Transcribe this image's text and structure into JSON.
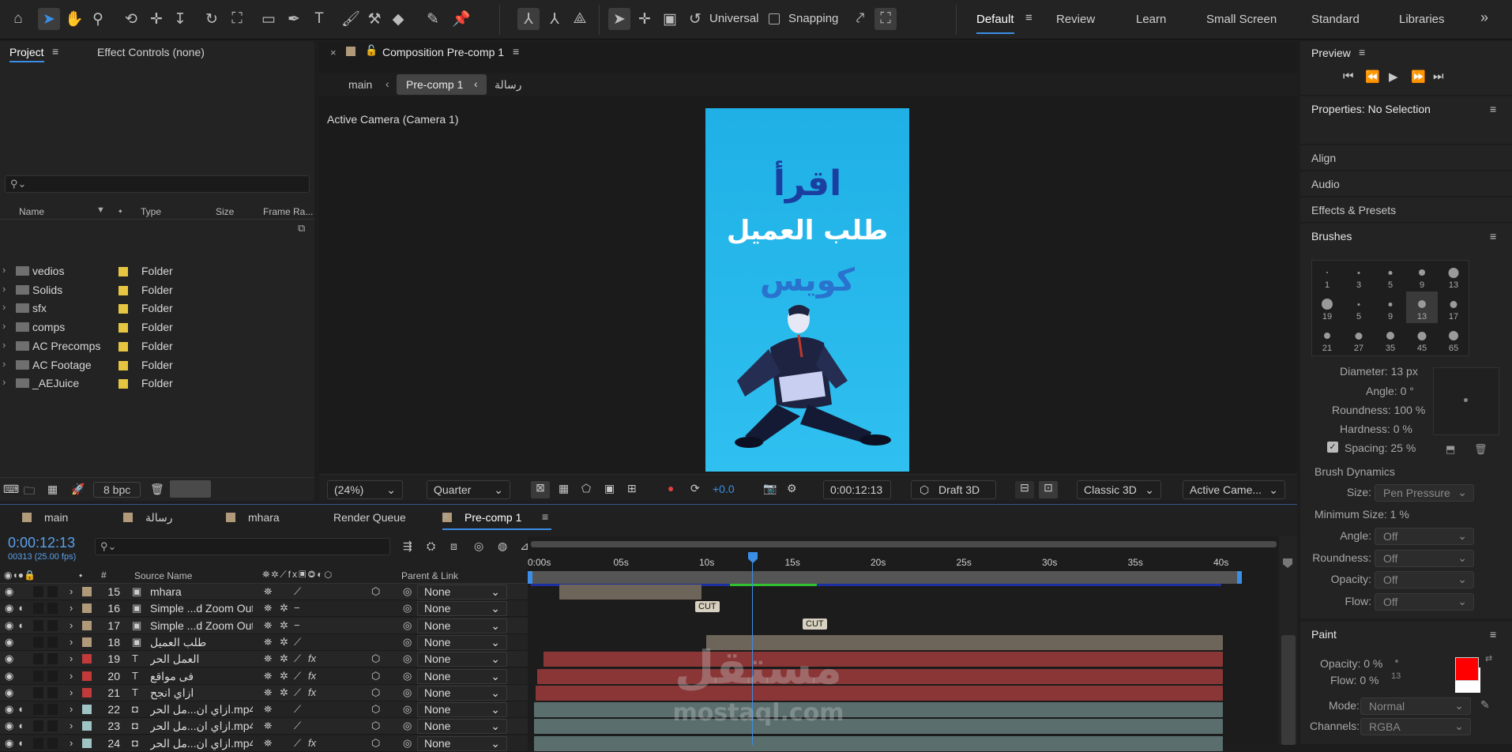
{
  "workspaces": [
    "Default",
    "Review",
    "Learn",
    "Small Screen",
    "Standard",
    "Libraries"
  ],
  "toolbar": {
    "universal": "Universal",
    "snapping": "Snapping"
  },
  "project": {
    "tab_project": "Project",
    "tab_effect": "Effect Controls (none)",
    "cols": {
      "name": "Name",
      "type": "Type",
      "size": "Size",
      "framerate": "Frame Ra..."
    },
    "items": [
      {
        "name": "vedios",
        "type": "Folder"
      },
      {
        "name": "Solids",
        "type": "Folder"
      },
      {
        "name": "sfx",
        "type": "Folder"
      },
      {
        "name": "comps",
        "type": "Folder"
      },
      {
        "name": "AC Precomps",
        "type": "Folder"
      },
      {
        "name": "AC Footage",
        "type": "Folder"
      },
      {
        "name": "_AEJuice",
        "type": "Folder"
      }
    ],
    "bpc": "8 bpc"
  },
  "comp": {
    "tab": "Composition Pre-comp 1",
    "breadcrumb": [
      "main",
      "Pre-comp 1",
      "رسالة"
    ],
    "camera": "Active Camera (Camera 1)",
    "art": {
      "line1": "اقرأ",
      "line2": "طلب العميل",
      "line3": "كويس"
    },
    "zoom": "(24%)",
    "resolution": "Quarter",
    "exposure": "+0.0",
    "timecode": "0:00:12:13",
    "renderer": "Draft 3D",
    "renderer_mode": "Classic 3D",
    "view": "Active Came..."
  },
  "preview": {
    "title": "Preview"
  },
  "properties": {
    "title": "Properties: No Selection"
  },
  "sections": [
    "Align",
    "Audio",
    "Effects & Presets"
  ],
  "brushes": {
    "title": "Brushes",
    "sizes": [
      "1",
      "3",
      "5",
      "9",
      "13",
      "19",
      "5",
      "9",
      "13",
      "17",
      "21",
      "27",
      "35",
      "45",
      "65"
    ],
    "diameter": "Diameter: 13 px",
    "angle": "Angle: 0 °",
    "roundness": "Roundness: 100 %",
    "hardness": "Hardness: 0 %",
    "spacing": "Spacing: 25 %",
    "dynamics_title": "Brush Dynamics",
    "dynamics": [
      {
        "label": "Size:",
        "value": "Pen Pressure"
      },
      {
        "label": "Minimum Size: 1 %",
        "value": ""
      },
      {
        "label": "Angle:",
        "value": "Off"
      },
      {
        "label": "Roundness:",
        "value": "Off"
      },
      {
        "label": "Opacity:",
        "value": "Off"
      },
      {
        "label": "Flow:",
        "value": "Off"
      }
    ]
  },
  "paint": {
    "title": "Paint",
    "opacity": "Opacity: 0 %",
    "flow": "Flow: 0 %",
    "brush_num": "13",
    "mode_label": "Mode:",
    "mode": "Normal",
    "channels_label": "Channels:",
    "channels": "RGBA",
    "fg": "#ff0000",
    "bg": "#ffffff"
  },
  "timeline": {
    "tabs": [
      "main",
      "رسالة",
      "mhara",
      "Render Queue",
      "Pre-comp 1"
    ],
    "timecode": "0:00:12:13",
    "frames": "00313 (25.00 fps)",
    "cols": {
      "source": "Source Name",
      "parent": "Parent & Link"
    },
    "ruler": [
      "0:00s",
      "05s",
      "10s",
      "15s",
      "20s",
      "25s",
      "30s",
      "35s",
      "40s"
    ],
    "layers": [
      {
        "num": "15",
        "name": "mhara",
        "color": "#b09a7a",
        "parent": "None"
      },
      {
        "num": "16",
        "name": "Simple ...d Zoom Out",
        "color": "#b09a7a",
        "parent": "None"
      },
      {
        "num": "17",
        "name": "Simple ...d Zoom Out",
        "color": "#b09a7a",
        "parent": "None"
      },
      {
        "num": "18",
        "name": "طلب العميل",
        "color": "#b09a7a",
        "parent": "None"
      },
      {
        "num": "19",
        "name": "العمل الحر",
        "color": "#c23a3a",
        "parent": "None"
      },
      {
        "num": "20",
        "name": "فى مواقع",
        "color": "#c23a3a",
        "parent": "None"
      },
      {
        "num": "21",
        "name": "ازاي انجح",
        "color": "#c23a3a",
        "parent": "None"
      },
      {
        "num": "22",
        "name": "ازاي ان...مل الحر.mp4",
        "color": "#9fc4c4",
        "parent": "None"
      },
      {
        "num": "23",
        "name": "ازاي ان...مل الحر.mp4",
        "color": "#9fc4c4",
        "parent": "None"
      },
      {
        "num": "24",
        "name": "ازاي ان...مل الحر.mp4",
        "color": "#9fc4c4",
        "parent": "None"
      }
    ],
    "cut": "CUT"
  },
  "watermark": {
    "ar": "مستقل",
    "en": "mostaql.com"
  }
}
